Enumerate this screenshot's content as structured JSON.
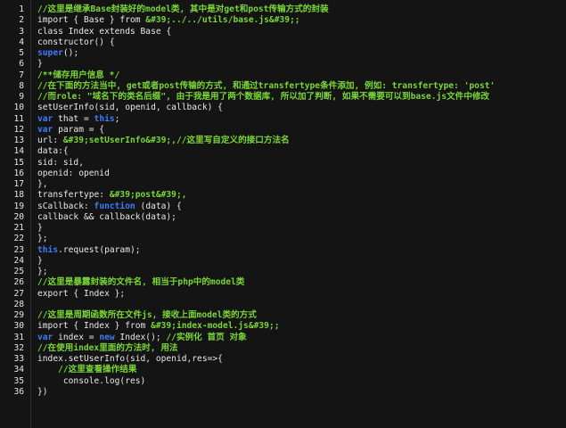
{
  "editor": {
    "lines": [
      {
        "num": "1",
        "tokens": [
          {
            "t": "cmt",
            "v": "//这里是继承Base封装好的model类, 其中是对get和post传输方式的封装"
          }
        ]
      },
      {
        "num": "2",
        "tokens": [
          {
            "t": "plain",
            "v": "import { Base } from "
          },
          {
            "t": "str",
            "v": "&#39;../../utils/base.js&#39;;"
          }
        ]
      },
      {
        "num": "3",
        "tokens": [
          {
            "t": "plain",
            "v": "class Index extends Base {"
          }
        ]
      },
      {
        "num": "4",
        "tokens": [
          {
            "t": "plain",
            "v": "constructor() {"
          }
        ]
      },
      {
        "num": "5",
        "tokens": [
          {
            "t": "kw",
            "v": "super"
          },
          {
            "t": "plain",
            "v": "();"
          }
        ]
      },
      {
        "num": "6",
        "tokens": [
          {
            "t": "plain",
            "v": "}"
          }
        ]
      },
      {
        "num": "7",
        "tokens": [
          {
            "t": "cmt",
            "v": "/**储存用户信息 */"
          }
        ]
      },
      {
        "num": "8",
        "tokens": [
          {
            "t": "cmt",
            "v": "//在下面的方法当中, get或者post传输的方式, 和通过transfertype条件添加, 例如: transfertype: 'post'"
          }
        ]
      },
      {
        "num": "9",
        "tokens": [
          {
            "t": "cmt",
            "v": "//而role: \"域名下的类名后缀\", 由于我是用了两个数据库, 所以加了判断, 如果不需要可以到base.js文件中修改"
          }
        ]
      },
      {
        "num": "10",
        "tokens": [
          {
            "t": "plain",
            "v": "setUserInfo(sid, openid, callback) {"
          }
        ]
      },
      {
        "num": "11",
        "tokens": [
          {
            "t": "kw",
            "v": "var"
          },
          {
            "t": "plain",
            "v": " that = "
          },
          {
            "t": "kw",
            "v": "this"
          },
          {
            "t": "plain",
            "v": ";"
          }
        ]
      },
      {
        "num": "12",
        "tokens": [
          {
            "t": "kw",
            "v": "var"
          },
          {
            "t": "plain",
            "v": " param = {"
          }
        ]
      },
      {
        "num": "13",
        "tokens": [
          {
            "t": "plain",
            "v": "url: "
          },
          {
            "t": "str",
            "v": "&#39;setUserInfo&#39;,//这里写自定义的接口方法名"
          }
        ]
      },
      {
        "num": "14",
        "tokens": [
          {
            "t": "plain",
            "v": "data:{"
          }
        ]
      },
      {
        "num": "15",
        "tokens": [
          {
            "t": "plain",
            "v": "sid: sid,"
          }
        ]
      },
      {
        "num": "16",
        "tokens": [
          {
            "t": "plain",
            "v": "openid: openid"
          }
        ]
      },
      {
        "num": "17",
        "tokens": [
          {
            "t": "plain",
            "v": "},"
          }
        ]
      },
      {
        "num": "18",
        "tokens": [
          {
            "t": "plain",
            "v": "transfertype: "
          },
          {
            "t": "str",
            "v": "&#39;post&#39;,"
          }
        ]
      },
      {
        "num": "19",
        "tokens": [
          {
            "t": "plain",
            "v": "sCallback: "
          },
          {
            "t": "kw",
            "v": "function"
          },
          {
            "t": "plain",
            "v": " (data) {"
          }
        ]
      },
      {
        "num": "20",
        "tokens": [
          {
            "t": "plain",
            "v": "callback && callback(data);"
          }
        ]
      },
      {
        "num": "21",
        "tokens": [
          {
            "t": "plain",
            "v": "}"
          }
        ]
      },
      {
        "num": "22",
        "tokens": [
          {
            "t": "plain",
            "v": "};"
          }
        ]
      },
      {
        "num": "23",
        "tokens": [
          {
            "t": "kw",
            "v": "this"
          },
          {
            "t": "plain",
            "v": ".request(param);"
          }
        ]
      },
      {
        "num": "24",
        "tokens": [
          {
            "t": "plain",
            "v": "}"
          }
        ]
      },
      {
        "num": "25",
        "tokens": [
          {
            "t": "plain",
            "v": "};"
          }
        ]
      },
      {
        "num": "26",
        "tokens": [
          {
            "t": "cmt",
            "v": "//这里是暴露封装的文件名, 相当于php中的model类"
          }
        ]
      },
      {
        "num": "27",
        "tokens": [
          {
            "t": "plain",
            "v": "export { Index };"
          }
        ]
      },
      {
        "num": "28",
        "tokens": []
      },
      {
        "num": "29",
        "tokens": [
          {
            "t": "cmt",
            "v": "//这里是周期函数所在文件js, 接收上面model类的方式"
          }
        ]
      },
      {
        "num": "30",
        "tokens": [
          {
            "t": "plain",
            "v": "import { Index } from "
          },
          {
            "t": "str",
            "v": "&#39;index-model.js&#39;;"
          }
        ]
      },
      {
        "num": "31",
        "tokens": [
          {
            "t": "kw",
            "v": "var"
          },
          {
            "t": "plain",
            "v": " index = "
          },
          {
            "t": "kw",
            "v": "new"
          },
          {
            "t": "plain",
            "v": " Index(); "
          },
          {
            "t": "cmt",
            "v": "//实例化 首页 对象"
          }
        ]
      },
      {
        "num": "32",
        "tokens": [
          {
            "t": "cmt",
            "v": "//在使用index里面的方法时, 用法"
          }
        ]
      },
      {
        "num": "33",
        "tokens": [
          {
            "t": "plain",
            "v": "index.setUserInfo(sid, openid,res=>{"
          }
        ]
      },
      {
        "num": "34",
        "tokens": [
          {
            "t": "plain",
            "v": "    "
          },
          {
            "t": "cmt",
            "v": "//这里查看操作结果"
          }
        ]
      },
      {
        "num": "35",
        "tokens": [
          {
            "t": "plain",
            "v": "     console.log(res)"
          }
        ]
      },
      {
        "num": "36",
        "tokens": [
          {
            "t": "plain",
            "v": "})"
          }
        ]
      }
    ]
  },
  "colors": {
    "background": "#141414",
    "comment": "#7ad636",
    "keyword": "#3d7cf5",
    "plain": "#e8e8e8",
    "line_number": "#e6e6e6"
  }
}
